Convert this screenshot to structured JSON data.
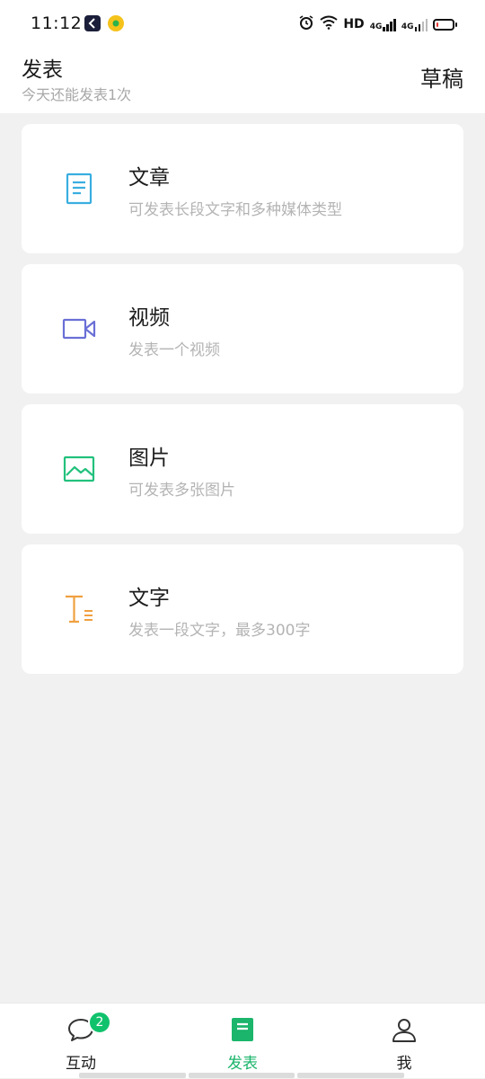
{
  "status_bar": {
    "time": "11:12",
    "hd_label": "HD",
    "network_1": "4G",
    "network_2": "4G",
    "battery_level": 0.15,
    "battery_color": "#e53935",
    "icons": [
      "app-k-icon",
      "app-g-icon",
      "alarm-icon",
      "wifi-icon",
      "signal-icon",
      "battery-icon"
    ]
  },
  "header": {
    "title": "发表",
    "subtitle": "今天还能发表1次",
    "drafts_label": "草稿"
  },
  "cards": [
    {
      "title": "文章",
      "desc": "可发表长段文字和多种媒体类型",
      "icon": "article-icon",
      "color": "#3aaee0"
    },
    {
      "title": "视频",
      "desc": "发表一个视频",
      "icon": "video-icon",
      "color": "#6a6fd6"
    },
    {
      "title": "图片",
      "desc": "可发表多张图片",
      "icon": "image-icon",
      "color": "#22c17c"
    },
    {
      "title": "文字",
      "desc": "发表一段文字，最多300字",
      "icon": "text-icon",
      "color": "#f0a040"
    }
  ],
  "bottom_nav": {
    "items": [
      {
        "label": "互动",
        "icon": "chat-icon",
        "badge": "2"
      },
      {
        "label": "发表",
        "icon": "publish-icon",
        "active": true
      },
      {
        "label": "我",
        "icon": "profile-icon"
      }
    ],
    "active_color": "#1bb56b",
    "badge_color": "#11c26d"
  }
}
